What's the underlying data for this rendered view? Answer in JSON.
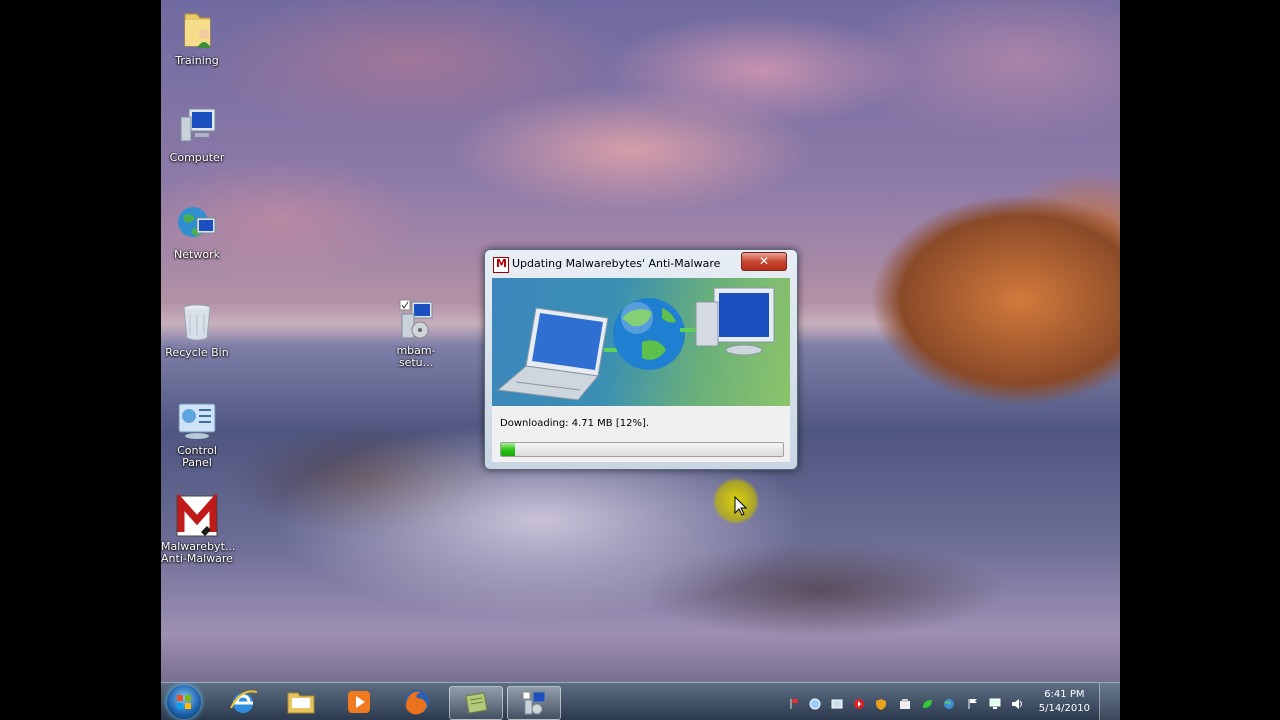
{
  "desktop": {
    "icons": [
      {
        "label": "Training"
      },
      {
        "label": "Computer"
      },
      {
        "label": "Network"
      },
      {
        "label": "Recycle Bin"
      },
      {
        "label": "mbam-setu..."
      },
      {
        "label": "Control Panel"
      },
      {
        "label": "Malwarebyt...\nAnti-Malware",
        "line1": "Malwarebyt...",
        "line2": "Anti-Malware"
      }
    ]
  },
  "dialog": {
    "title": "Updating Malwarebytes' Anti-Malware",
    "close_label": "✕",
    "status": "Downloading: 4.71 MB [12%].",
    "progress": 0.05
  },
  "taskbar": {
    "time": "6:41 PM",
    "date": "5/14/2010",
    "pinned": [
      "internet-explorer-icon",
      "windows-explorer-icon",
      "media-player-icon",
      "firefox-icon",
      "notepad-icon",
      "installer-icon"
    ],
    "tray_icons": [
      "flag-pin-icon",
      "circle-icon",
      "window-icon",
      "red-play-icon",
      "shield-check-icon",
      "box-icon",
      "green-leaf-icon",
      "network-globe-icon",
      "flag-icon",
      "monitor-icon",
      "speaker-icon"
    ]
  },
  "colors": {
    "progress_green": "#2ec21b",
    "close_red": "#c84833"
  }
}
